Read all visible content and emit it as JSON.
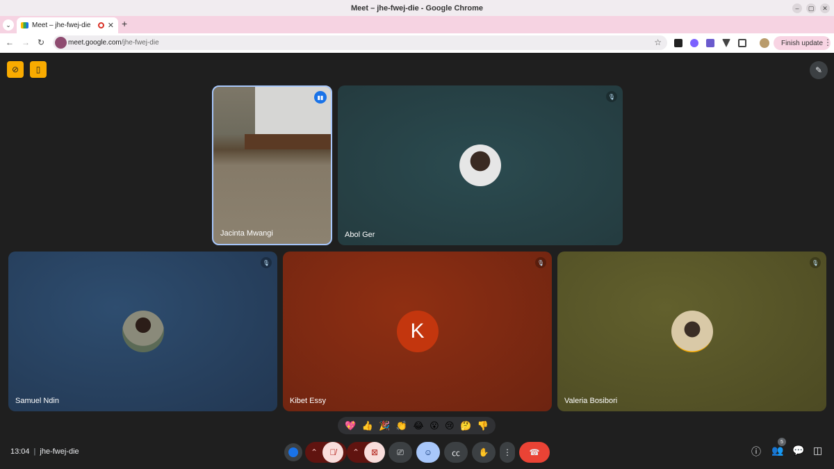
{
  "window": {
    "title": "Meet – jhe-fwej-die - Google Chrome"
  },
  "tab": {
    "title": "Meet – jhe-fwej-die"
  },
  "omnibox": {
    "host": "meet.google.com",
    "path": "/jhe-fwej-die"
  },
  "toolbar": {
    "finish_update": "Finish update"
  },
  "participants": [
    {
      "name": "Jacinta Mwangi"
    },
    {
      "name": "Abol Ger"
    },
    {
      "name": "Samuel Ndin"
    },
    {
      "name": "Kibet Essy",
      "initial": "K"
    },
    {
      "name": "Valeria Bosibori"
    }
  ],
  "reactions": [
    "💖",
    "👍",
    "🎉",
    "👏",
    "😂",
    "😮",
    "😢",
    "🤔",
    "👎"
  ],
  "meeting": {
    "time": "13:04",
    "separator": "|",
    "code": "jhe-fwej-die"
  },
  "people_count": "5",
  "colors": {
    "accent": "#a8c7fa",
    "end_call": "#ea4335",
    "host_badge": "#f9ab00"
  }
}
